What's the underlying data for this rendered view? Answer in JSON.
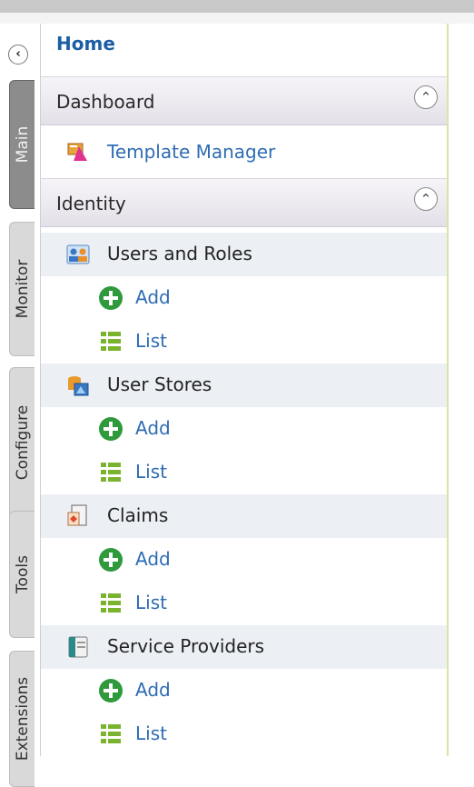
{
  "nav": {
    "collapse_glyph": "‹",
    "tabs": [
      {
        "label": "Main",
        "active": true
      },
      {
        "label": "Monitor",
        "active": false
      },
      {
        "label": "Configure",
        "active": false
      },
      {
        "label": "Tools",
        "active": false
      },
      {
        "label": "Extensions",
        "active": false
      }
    ]
  },
  "menu": {
    "home": "Home",
    "dashboard": {
      "label": "Dashboard",
      "toggle_glyph": "⌃",
      "items": [
        {
          "label": "Template Manager",
          "icon": "template-icon"
        }
      ]
    },
    "identity": {
      "label": "Identity",
      "toggle_glyph": "⌃",
      "groups": [
        {
          "label": "Users and Roles",
          "icon": "users-roles-icon",
          "add": "Add",
          "list": "List"
        },
        {
          "label": "User Stores",
          "icon": "user-stores-icon",
          "add": "Add",
          "list": "List"
        },
        {
          "label": "Claims",
          "icon": "claims-icon",
          "add": "Add",
          "list": "List"
        },
        {
          "label": "Service Providers",
          "icon": "service-providers-icon",
          "add": "Add",
          "list": "List"
        }
      ]
    }
  },
  "colors": {
    "link": "#2e6cb3",
    "home": "#1c5ea6",
    "add_icon": "#2e9a3c",
    "list_icon": "#7ab32e",
    "group_bg": "#ecf0f5"
  }
}
